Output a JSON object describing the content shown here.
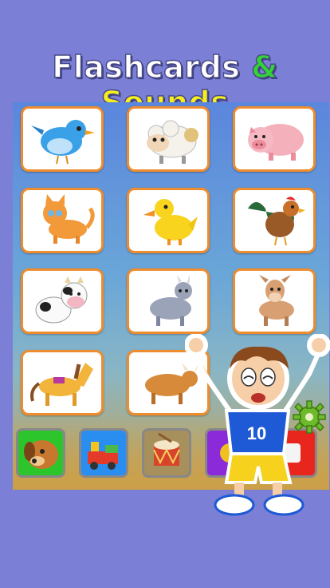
{
  "header": {
    "title_part1": "Flashcards",
    "title_amp": "&",
    "title_part2": "Sounds"
  },
  "colors": {
    "background": "#7b80d6",
    "card_border": "#ee8d2e",
    "amp": "#34d334",
    "sounds": "#f6ef1c"
  },
  "cards": [
    {
      "icon": "bird-icon"
    },
    {
      "icon": "sheep-icon"
    },
    {
      "icon": "pig-icon"
    },
    {
      "icon": "cat-icon"
    },
    {
      "icon": "duck-icon"
    },
    {
      "icon": "rooster-icon"
    },
    {
      "icon": "cow-icon"
    },
    {
      "icon": "goat-icon"
    },
    {
      "icon": "donkey-icon"
    },
    {
      "icon": "horse-icon"
    },
    {
      "icon": "bull-icon"
    }
  ],
  "category_buttons": [
    {
      "icon": "dog-icon"
    },
    {
      "icon": "train-icon"
    },
    {
      "icon": "drum-icon"
    },
    {
      "icon": "purple-category-icon"
    },
    {
      "icon": "red-category-icon"
    }
  ],
  "settings": {
    "icon": "gear-icon"
  },
  "mascot": {
    "icon": "boy-mascot-icon",
    "jersey_number": "10"
  }
}
